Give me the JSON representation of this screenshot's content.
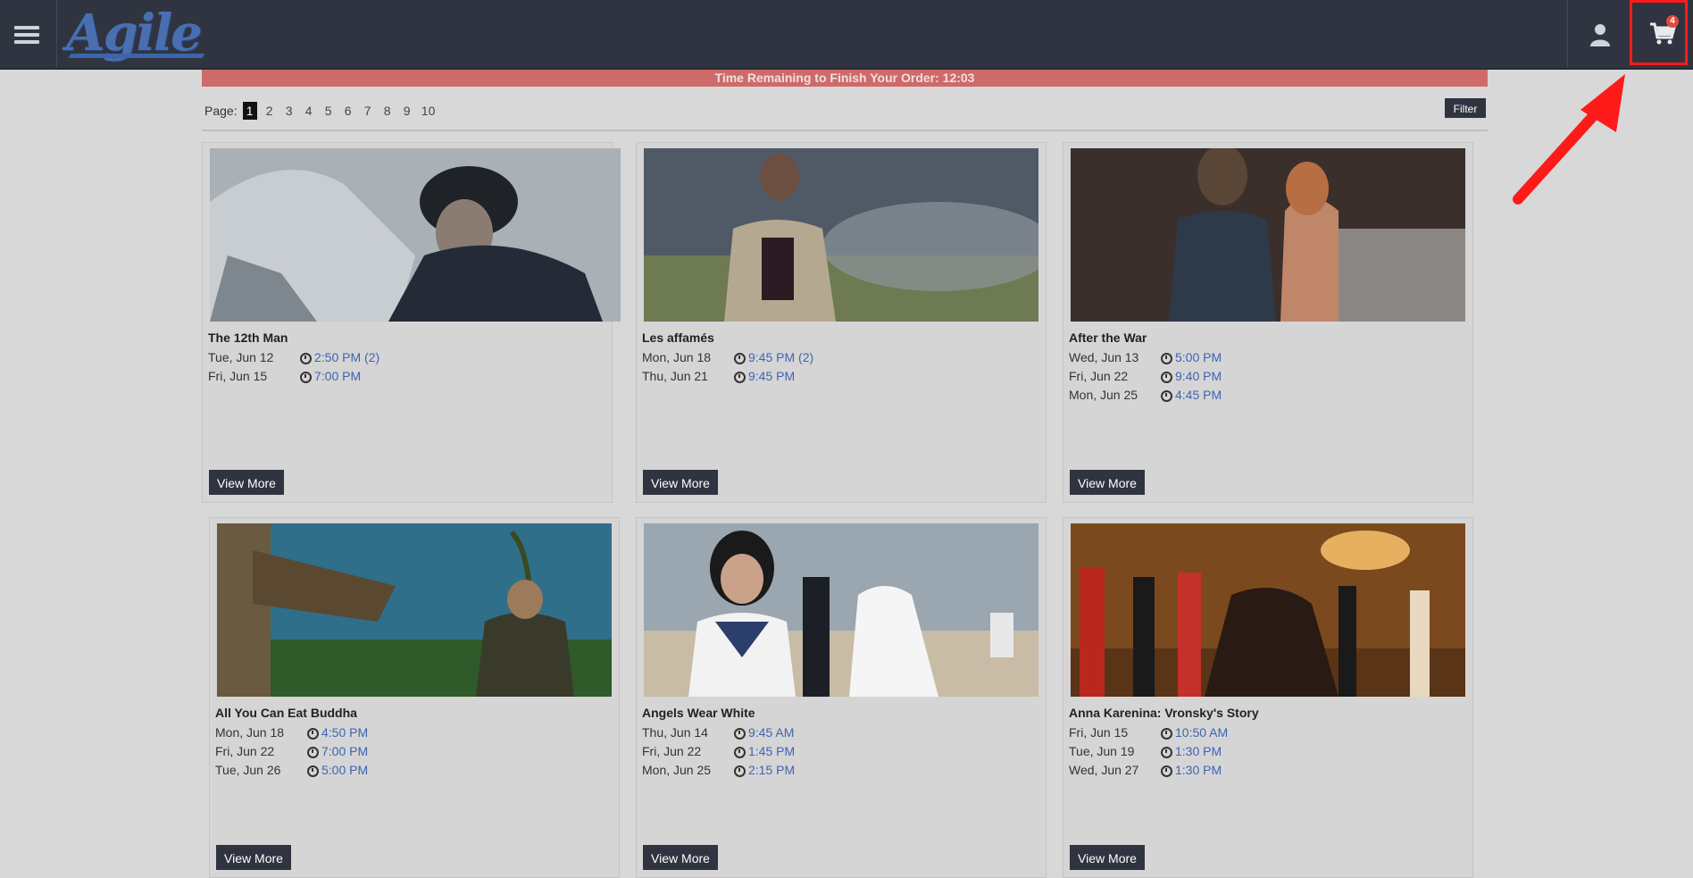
{
  "header": {
    "logo_text": "Agile",
    "cart_count": "4"
  },
  "timer": {
    "text": "Time Remaining to Finish Your Order: 12:03"
  },
  "pager": {
    "label": "Page:",
    "pages": [
      "1",
      "2",
      "3",
      "4",
      "5",
      "6",
      "7",
      "8",
      "9",
      "10"
    ],
    "filter_label": "Filter"
  },
  "films": [
    {
      "title": "The 12th Man",
      "showings": [
        {
          "date": "Tue, Jun 12",
          "time": "2:50 PM (2)"
        },
        {
          "date": "Fri, Jun 15",
          "time": "7:00 PM"
        }
      ],
      "button": "View More"
    },
    {
      "title": "Les affamés",
      "showings": [
        {
          "date": "Mon, Jun 18",
          "time": "9:45 PM (2)"
        },
        {
          "date": "Thu, Jun 21",
          "time": "9:45 PM"
        }
      ],
      "button": "View More"
    },
    {
      "title": "After the War",
      "showings": [
        {
          "date": "Wed, Jun 13",
          "time": "5:00 PM"
        },
        {
          "date": "Fri, Jun 22",
          "time": "9:40 PM"
        },
        {
          "date": "Mon, Jun 25",
          "time": "4:45 PM"
        }
      ],
      "button": "View More"
    },
    {
      "title": "All You Can Eat Buddha",
      "showings": [
        {
          "date": "Mon, Jun 18",
          "time": "4:50 PM"
        },
        {
          "date": "Fri, Jun 22",
          "time": "7:00 PM"
        },
        {
          "date": "Tue, Jun 26",
          "time": "5:00 PM"
        }
      ],
      "button": "View More"
    },
    {
      "title": "Angels Wear White",
      "showings": [
        {
          "date": "Thu, Jun 14",
          "time": "9:45 AM"
        },
        {
          "date": "Fri, Jun 22",
          "time": "1:45 PM"
        },
        {
          "date": "Mon, Jun 25",
          "time": "2:15 PM"
        }
      ],
      "button": "View More"
    },
    {
      "title": "Anna Karenina: Vronsky's Story",
      "showings": [
        {
          "date": "Fri, Jun 15",
          "time": "10:50 AM"
        },
        {
          "date": "Tue, Jun 19",
          "time": "1:30 PM"
        },
        {
          "date": "Wed, Jun 27",
          "time": "1:30 PM"
        }
      ],
      "button": "View More"
    }
  ],
  "colors": {
    "header_bg": "#2f3440",
    "timer_bg": "#cf6a6a",
    "link": "#3f64b2",
    "highlight": "#ff1a1a"
  },
  "icons": [
    "menu-icon",
    "user-icon",
    "cart-icon",
    "clock-icon",
    "annotation-arrow"
  ]
}
